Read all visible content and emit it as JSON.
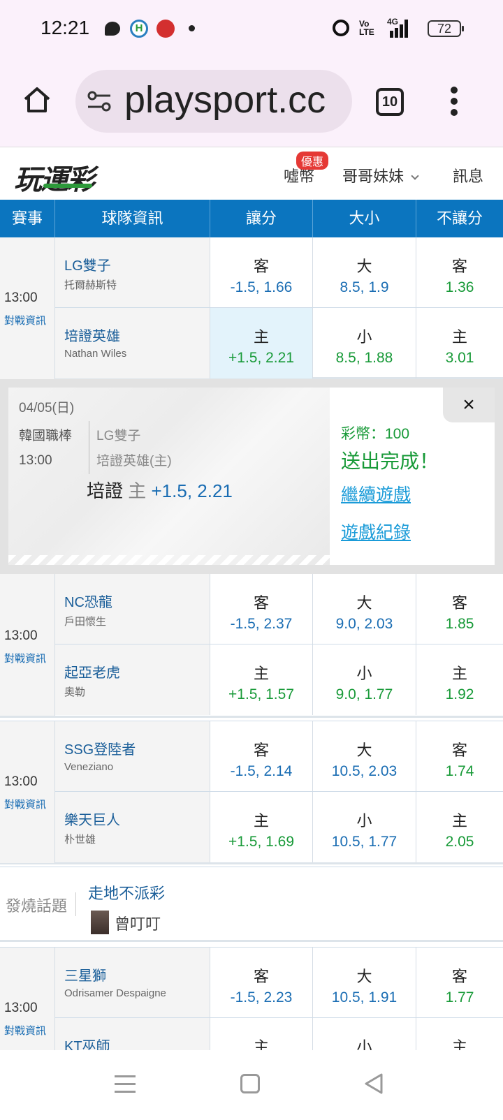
{
  "status": {
    "time": "12:21",
    "battery": "72",
    "network": "4G"
  },
  "browser": {
    "url": "playsport.cc",
    "tab_count": "10"
  },
  "header": {
    "logo": "玩運彩",
    "coins": "噓幣",
    "promo_badge": "優惠",
    "user": "哥哥妹妹",
    "messages": "訊息"
  },
  "table_head": [
    "賽事",
    "球隊資訊",
    "讓分",
    "大小",
    "不讓分"
  ],
  "games": [
    {
      "time": "13:00",
      "vs_link": "對戰資訊",
      "rows": [
        {
          "team": "LG雙子",
          "pitcher": "托爾赫斯特",
          "spread_label": "客",
          "spread": "-1.5, 1.66",
          "total_label": "大",
          "total": "8.5, 1.9",
          "ml_label": "客",
          "ml": "1.36"
        },
        {
          "team": "培證英雄",
          "pitcher": "Nathan Wiles",
          "spread_label": "主",
          "spread": "+1.5, 2.21",
          "total_label": "小",
          "total": "8.5, 1.88",
          "ml_label": "主",
          "ml": "3.01"
        }
      ]
    },
    {
      "time": "13:00",
      "vs_link": "對戰資訊",
      "rows": [
        {
          "team": "NC恐龍",
          "pitcher": "戶田懷生",
          "spread_label": "客",
          "spread": "-1.5, 2.37",
          "total_label": "大",
          "total": "9.0, 2.03",
          "ml_label": "客",
          "ml": "1.85"
        },
        {
          "team": "起亞老虎",
          "pitcher": "奧勒",
          "spread_label": "主",
          "spread": "+1.5, 1.57",
          "total_label": "小",
          "total": "9.0, 1.77",
          "ml_label": "主",
          "ml": "1.92"
        }
      ]
    },
    {
      "time": "13:00",
      "vs_link": "對戰資訊",
      "rows": [
        {
          "team": "SSG登陸者",
          "pitcher": "Veneziano",
          "spread_label": "客",
          "spread": "-1.5, 2.14",
          "total_label": "大",
          "total": "10.5, 2.03",
          "ml_label": "客",
          "ml": "1.74"
        },
        {
          "team": "樂天巨人",
          "pitcher": "朴世雄",
          "spread_label": "主",
          "spread": "+1.5, 1.69",
          "total_label": "小",
          "total": "10.5, 1.77",
          "ml_label": "主",
          "ml": "2.05"
        }
      ]
    },
    {
      "time": "13:00",
      "vs_link": "對戰資訊",
      "rows": [
        {
          "team": "三星獅",
          "pitcher": "Odrisamer Despaigne",
          "spread_label": "客",
          "spread": "-1.5, 2.23",
          "total_label": "大",
          "total": "10.5, 1.91",
          "ml_label": "客",
          "ml": "1.77"
        },
        {
          "team": "KT巫師",
          "pitcher": "",
          "spread_label": "主",
          "spread": "",
          "total_label": "小",
          "total": "",
          "ml_label": "主",
          "ml": ""
        }
      ]
    }
  ],
  "ticket": {
    "date": "04/05(日)",
    "league": "韓國職棒",
    "time": "13:00",
    "away": "LG雙子",
    "home": "培證英雄(主)",
    "pick_team": "培證",
    "pick_side": "主",
    "pick_value": "+1.5, 2.21",
    "coins": "彩幣：100",
    "done": "送出完成！",
    "continue": "繼續遊戲",
    "history": "遊戲紀錄",
    "close": "×"
  },
  "hot_topic": {
    "label": "發燒話題",
    "title": "走地不派彩",
    "user": "曾叮叮"
  },
  "colors": {
    "table_header": "#0b75bf",
    "odds_blue": "#1a6db3",
    "odds_green": "#189a38",
    "link": "#1a9bd8",
    "badge": "#e53935"
  }
}
